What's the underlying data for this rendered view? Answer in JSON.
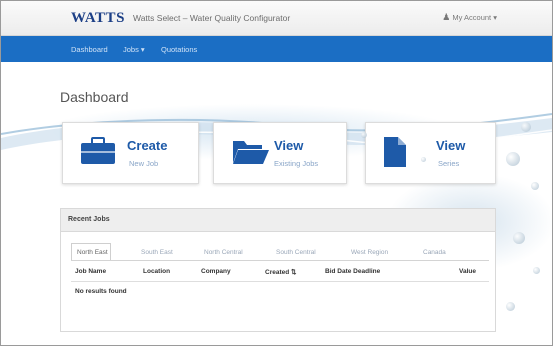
{
  "header": {
    "logo": "WATTS",
    "app_title": "Watts Select – Water Quality Configurator",
    "account_label": "My Account ▾"
  },
  "nav": {
    "items": [
      {
        "label": "Dashboard"
      },
      {
        "label": "Jobs ▾"
      },
      {
        "label": "Quotations"
      }
    ]
  },
  "dashboard": {
    "title": "Dashboard",
    "cards": [
      {
        "title": "Create",
        "subtitle": "New Job",
        "icon": "briefcase-icon"
      },
      {
        "title": "View",
        "subtitle": "Existing Jobs",
        "icon": "folder-icon"
      },
      {
        "title": "View",
        "subtitle": "Series",
        "icon": "document-icon"
      }
    ]
  },
  "recent_jobs": {
    "title": "Recent Jobs",
    "tabs": [
      "North East",
      "South East",
      "North Central",
      "South Central",
      "West Region",
      "Canada"
    ],
    "active_tab": 0,
    "columns": [
      "Job Name",
      "Location",
      "Company",
      "Created ⇅",
      "Bid Date Deadline",
      "Value"
    ],
    "empty_message": "No results found"
  },
  "colors": {
    "nav_blue": "#1b6ec4",
    "brand_blue": "#1e5aa8",
    "logo_navy": "#1c3f86"
  }
}
